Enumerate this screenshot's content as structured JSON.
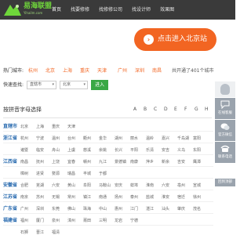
{
  "header": {
    "logo_text": "易海联盟",
    "logo_sub": "Yihailm.com",
    "nav": [
      "首页",
      "找要修修",
      "找修修公司",
      "找设计师",
      "效果图"
    ]
  },
  "banner": {
    "button_label": "点击进入北京站",
    "accent_color": "#f26522"
  },
  "hot": {
    "label": "热门城市:",
    "cities": [
      "杭州",
      "北京",
      "上海",
      "重庆",
      "天津",
      "广州",
      "深圳",
      "南昌"
    ],
    "count_text": "共开通了401个城市"
  },
  "quick": {
    "label": "快速查找:",
    "province_value": "直辖市",
    "city_value": "北京",
    "go_label": "进入"
  },
  "pinyin": {
    "title": "按拼音字母选择",
    "letters": [
      "A",
      "B",
      "C",
      "D",
      "E",
      "F",
      "G",
      "H",
      "J"
    ]
  },
  "provinces": [
    {
      "name": "直辖市",
      "cities": [
        "北京",
        "上海",
        "重庆",
        "天津"
      ]
    },
    {
      "name": "浙江省",
      "cities": [
        "杭州",
        "宁波",
        "温州",
        "台州",
        "衢州",
        "金华",
        "湖州",
        "丽水",
        "温岭",
        "嘉兴",
        "千岛湖",
        "富阳"
      ]
    },
    {
      "name": "",
      "cities": [
        "诸暨",
        "临安",
        "舟山",
        "上虞",
        "慈溪",
        "余姚",
        "长兴",
        "平阳",
        "乐清",
        "安吉",
        "义乌",
        "东阳"
      ]
    },
    {
      "name": "江西省",
      "cities": [
        "南昌",
        "抚州",
        "上饶",
        "宜春",
        "赣州",
        "九江",
        "景德镇",
        "南康",
        "萍乡",
        "新余",
        "吉安",
        "鹰潭"
      ]
    },
    {
      "name": "",
      "cities": [
        "樟树",
        "进贤",
        "婺源",
        "瑞昌",
        "丰城",
        "于都"
      ]
    },
    {
      "name": "安徽省",
      "cities": [
        "合肥",
        "芜湖",
        "六安",
        "黄山",
        "阜阳",
        "马鞍山",
        "安庆",
        "蚌埠",
        "淮南",
        "六安",
        "亳州",
        "宣城"
      ]
    },
    {
      "name": "江苏省",
      "cities": [
        "南京",
        "苏州",
        "无锡",
        "常州",
        "镇江",
        "南通",
        "扬州",
        "泰州",
        "盐城",
        "淮安",
        "宿迁",
        "徐州"
      ]
    },
    {
      "name": "广东省",
      "cities": [
        "广州",
        "深圳",
        "东莞",
        "佛山",
        "珠海",
        "中山",
        "惠州",
        "江门",
        "湛江",
        "汕头",
        "肇庆",
        "茂名"
      ]
    },
    {
      "name": "福建省",
      "cities": [
        "福州",
        "厦门",
        "泉州",
        "漳州",
        "莆田",
        "三明",
        "龙岩",
        "宁德"
      ]
    },
    {
      "name": "",
      "cities": [
        "石狮",
        "晋江",
        "福清"
      ]
    }
  ],
  "sidebar": {
    "items": [
      {
        "label": "在线客服",
        "icon": "chat-bubble-icon",
        "color": "#9aa3ad"
      },
      {
        "label": "官方微信",
        "icon": "wechat-icon",
        "color": "#9aa3ad"
      },
      {
        "label": "联系电话",
        "icon": "phone-icon",
        "color": "#9aa3ad"
      }
    ],
    "top_label": "回到顶部"
  }
}
